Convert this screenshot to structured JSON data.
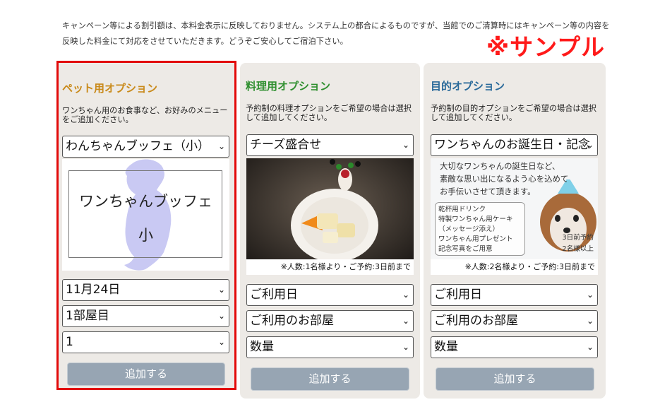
{
  "notice": {
    "line1": "キャンペーン等による割引額は、本料金表示に反映しておりません。システム上の都合によるものですが、当館でのご清算時にはキャンペーン等の内容を",
    "line2": "反映した料金にて対応をさせていただきます。どうぞご安心してご宿泊下さい。"
  },
  "sample_label": "※サンプル",
  "pet": {
    "title": "ペット用オプション",
    "desc": "ワンちゃん用のお食事など、お好みのメニューをご追加ください。",
    "menu_select": "わんちゃんブッフェ（小）",
    "image_line1": "ワンちゃんブッフェ",
    "image_line2": "小",
    "date_select": "11月24日",
    "room_select": "1部屋目",
    "qty_select": "1",
    "add_button": "追加する"
  },
  "cook": {
    "title": "料理用オプション",
    "desc": "予約制の料理オプションをご希望の場合は選択して追加してください。",
    "menu_select": "チーズ盛合せ",
    "image_note": "※人数:1名様より・ご予約:3日前まで",
    "date_select": "ご利用日",
    "room_select": "ご利用のお部屋",
    "qty_select": "数量",
    "add_button": "追加する"
  },
  "purpose": {
    "title": "目的オプション",
    "desc": "予約制の目的オプションをご希望の場合は選択して追加してください。",
    "menu_select": "ワンちゃんのお誕生日・記念",
    "image_text": [
      "大切なワンちゃんの誕生日など、",
      "素敵な思い出になるよう心を込めて",
      "お手伝いさせて頂きます。"
    ],
    "image_box": [
      "乾杯用ドリンク",
      "特製ワンちゃん用ケーキ",
      "（メッセージ添え）",
      "ワンちゃん用プレゼント",
      "記念写真をご用意"
    ],
    "image_side1": "3日前予約",
    "image_side2": "2名様以上",
    "image_note": "※人数:2名様より・ご予約:3日前まで",
    "date_select": "ご利用日",
    "room_select": "ご利用のお部屋",
    "qty_select": "数量",
    "add_button": "追加する"
  },
  "colors": {
    "pet_title": "#c98a1a",
    "cook_title": "#2f8f2f",
    "purpose_title": "#2a6a9a",
    "highlight_border": "#e20a0a",
    "sample_label": "#ff1a1a",
    "button_bg": "#97a5b3"
  },
  "icons": {
    "select_arrow": "chevron-down-icon"
  }
}
